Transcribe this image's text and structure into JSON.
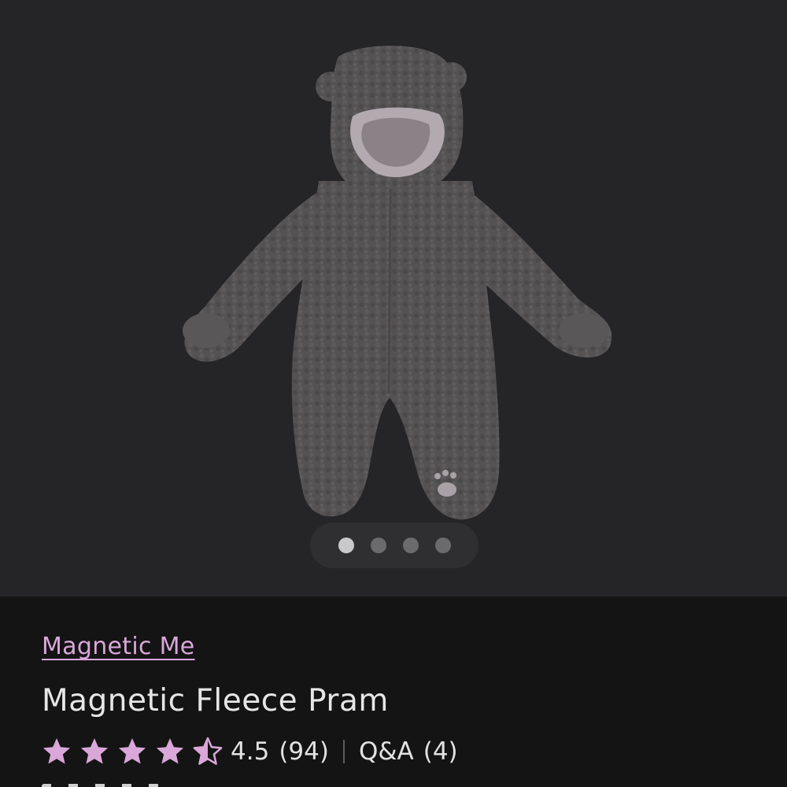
{
  "product": {
    "brand": "Magnetic Me",
    "title": "Magnetic Fleece Pram",
    "image_alt": "Grey fleece bear-ear pram suit",
    "rating": {
      "value": "4.5",
      "score": 4.5,
      "out_of": 5,
      "reviews_text": "(94)"
    },
    "qa": {
      "label": "Q&A",
      "count_text": "(4)"
    }
  },
  "gallery": {
    "total_images": 4,
    "active_index": 0
  },
  "colors": {
    "accent": "#d9a7d8",
    "star": "#d9a7d8",
    "gallery_bg": "#252426",
    "info_bg": "#141414",
    "text": "#e6e6e6"
  },
  "icons": {
    "star_full": "star-icon",
    "star_half": "half-star-icon"
  }
}
